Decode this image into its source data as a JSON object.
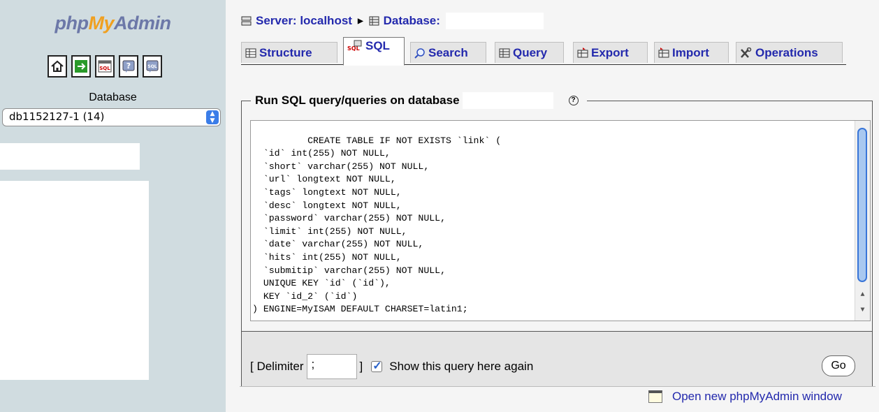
{
  "sidebar": {
    "logo": {
      "php": "php",
      "my": "My",
      "admin": "Admin"
    },
    "icons": [
      "home-icon",
      "exit-icon",
      "sql-icon",
      "docs-icon",
      "sql-docs-icon"
    ],
    "database_label": "Database",
    "database_selected": "db1152127-1 (14)"
  },
  "header": {
    "server_label": "Server: localhost",
    "database_label": "Database:"
  },
  "tabs": [
    {
      "label": "Structure",
      "icon": "structure-icon"
    },
    {
      "label": "SQL",
      "icon": "sql-icon",
      "active": true
    },
    {
      "label": "Search",
      "icon": "search-icon"
    },
    {
      "label": "Query",
      "icon": "query-icon"
    },
    {
      "label": "Export",
      "icon": "export-icon"
    },
    {
      "label": "Import",
      "icon": "import-icon"
    },
    {
      "label": "Operations",
      "icon": "operations-icon"
    }
  ],
  "query_panel": {
    "legend": "Run SQL query/queries on database",
    "sql": "CREATE TABLE IF NOT EXISTS `link` (\n  `id` int(255) NOT NULL,\n  `short` varchar(255) NOT NULL,\n  `url` longtext NOT NULL,\n  `tags` longtext NOT NULL,\n  `desc` longtext NOT NULL,\n  `password` varchar(255) NOT NULL,\n  `limit` int(255) NOT NULL,\n  `date` varchar(255) NOT NULL,\n  `hits` int(255) NOT NULL,\n  `submitip` varchar(255) NOT NULL,\n  UNIQUE KEY `id` (`id`),\n  KEY `id_2` (`id`)\n) ENGINE=MyISAM DEFAULT CHARSET=latin1;",
    "delimiter_open": "[ Delimiter",
    "delimiter_value": ";",
    "delimiter_close": "]",
    "show_again_label": "Show this query here again",
    "show_again_checked": true,
    "go_label": "Go"
  },
  "footer": {
    "new_window_label": "Open new phpMyAdmin window"
  }
}
